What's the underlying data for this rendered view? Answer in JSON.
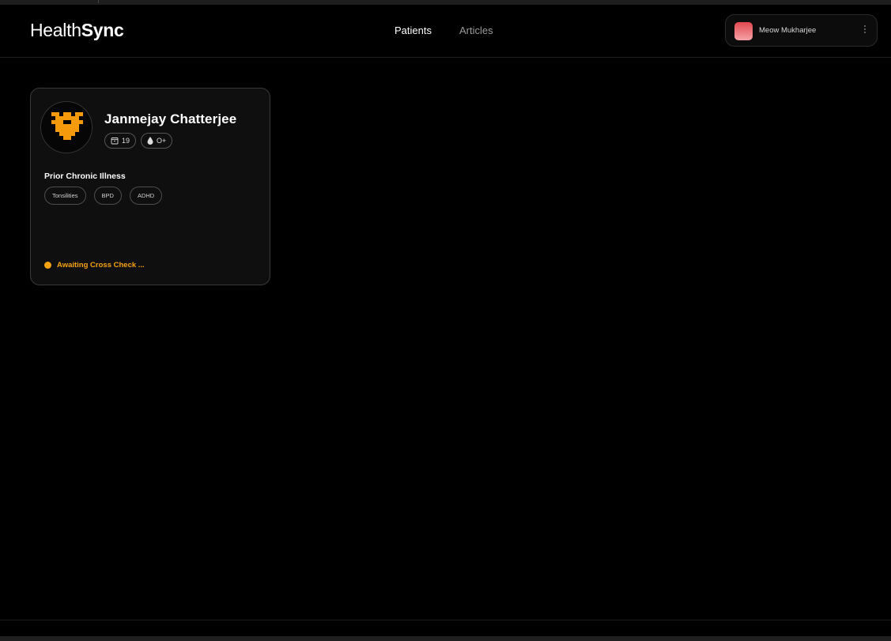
{
  "app": {
    "logo_light": "Health",
    "logo_bold": "Sync"
  },
  "nav": {
    "items": [
      {
        "label": "Patients",
        "active": true
      },
      {
        "label": "Articles",
        "active": false
      }
    ]
  },
  "user": {
    "name": "Meow Mukharjee",
    "avatar_gradient": [
      "#e0484f",
      "#f6a3a7"
    ]
  },
  "patient_card": {
    "name": "Janmejay Chatterjee",
    "age": "19",
    "blood_group": "O+",
    "illness_title": "Prior Chronic Illness",
    "illnesses": [
      "Tonsilities",
      "BPD",
      "ADHD"
    ],
    "status": "Awaiting Cross Check ...",
    "status_color": "#f5a210",
    "avatar_icon": "pixel-heart-icon",
    "avatar_color": "#f59b0b"
  }
}
